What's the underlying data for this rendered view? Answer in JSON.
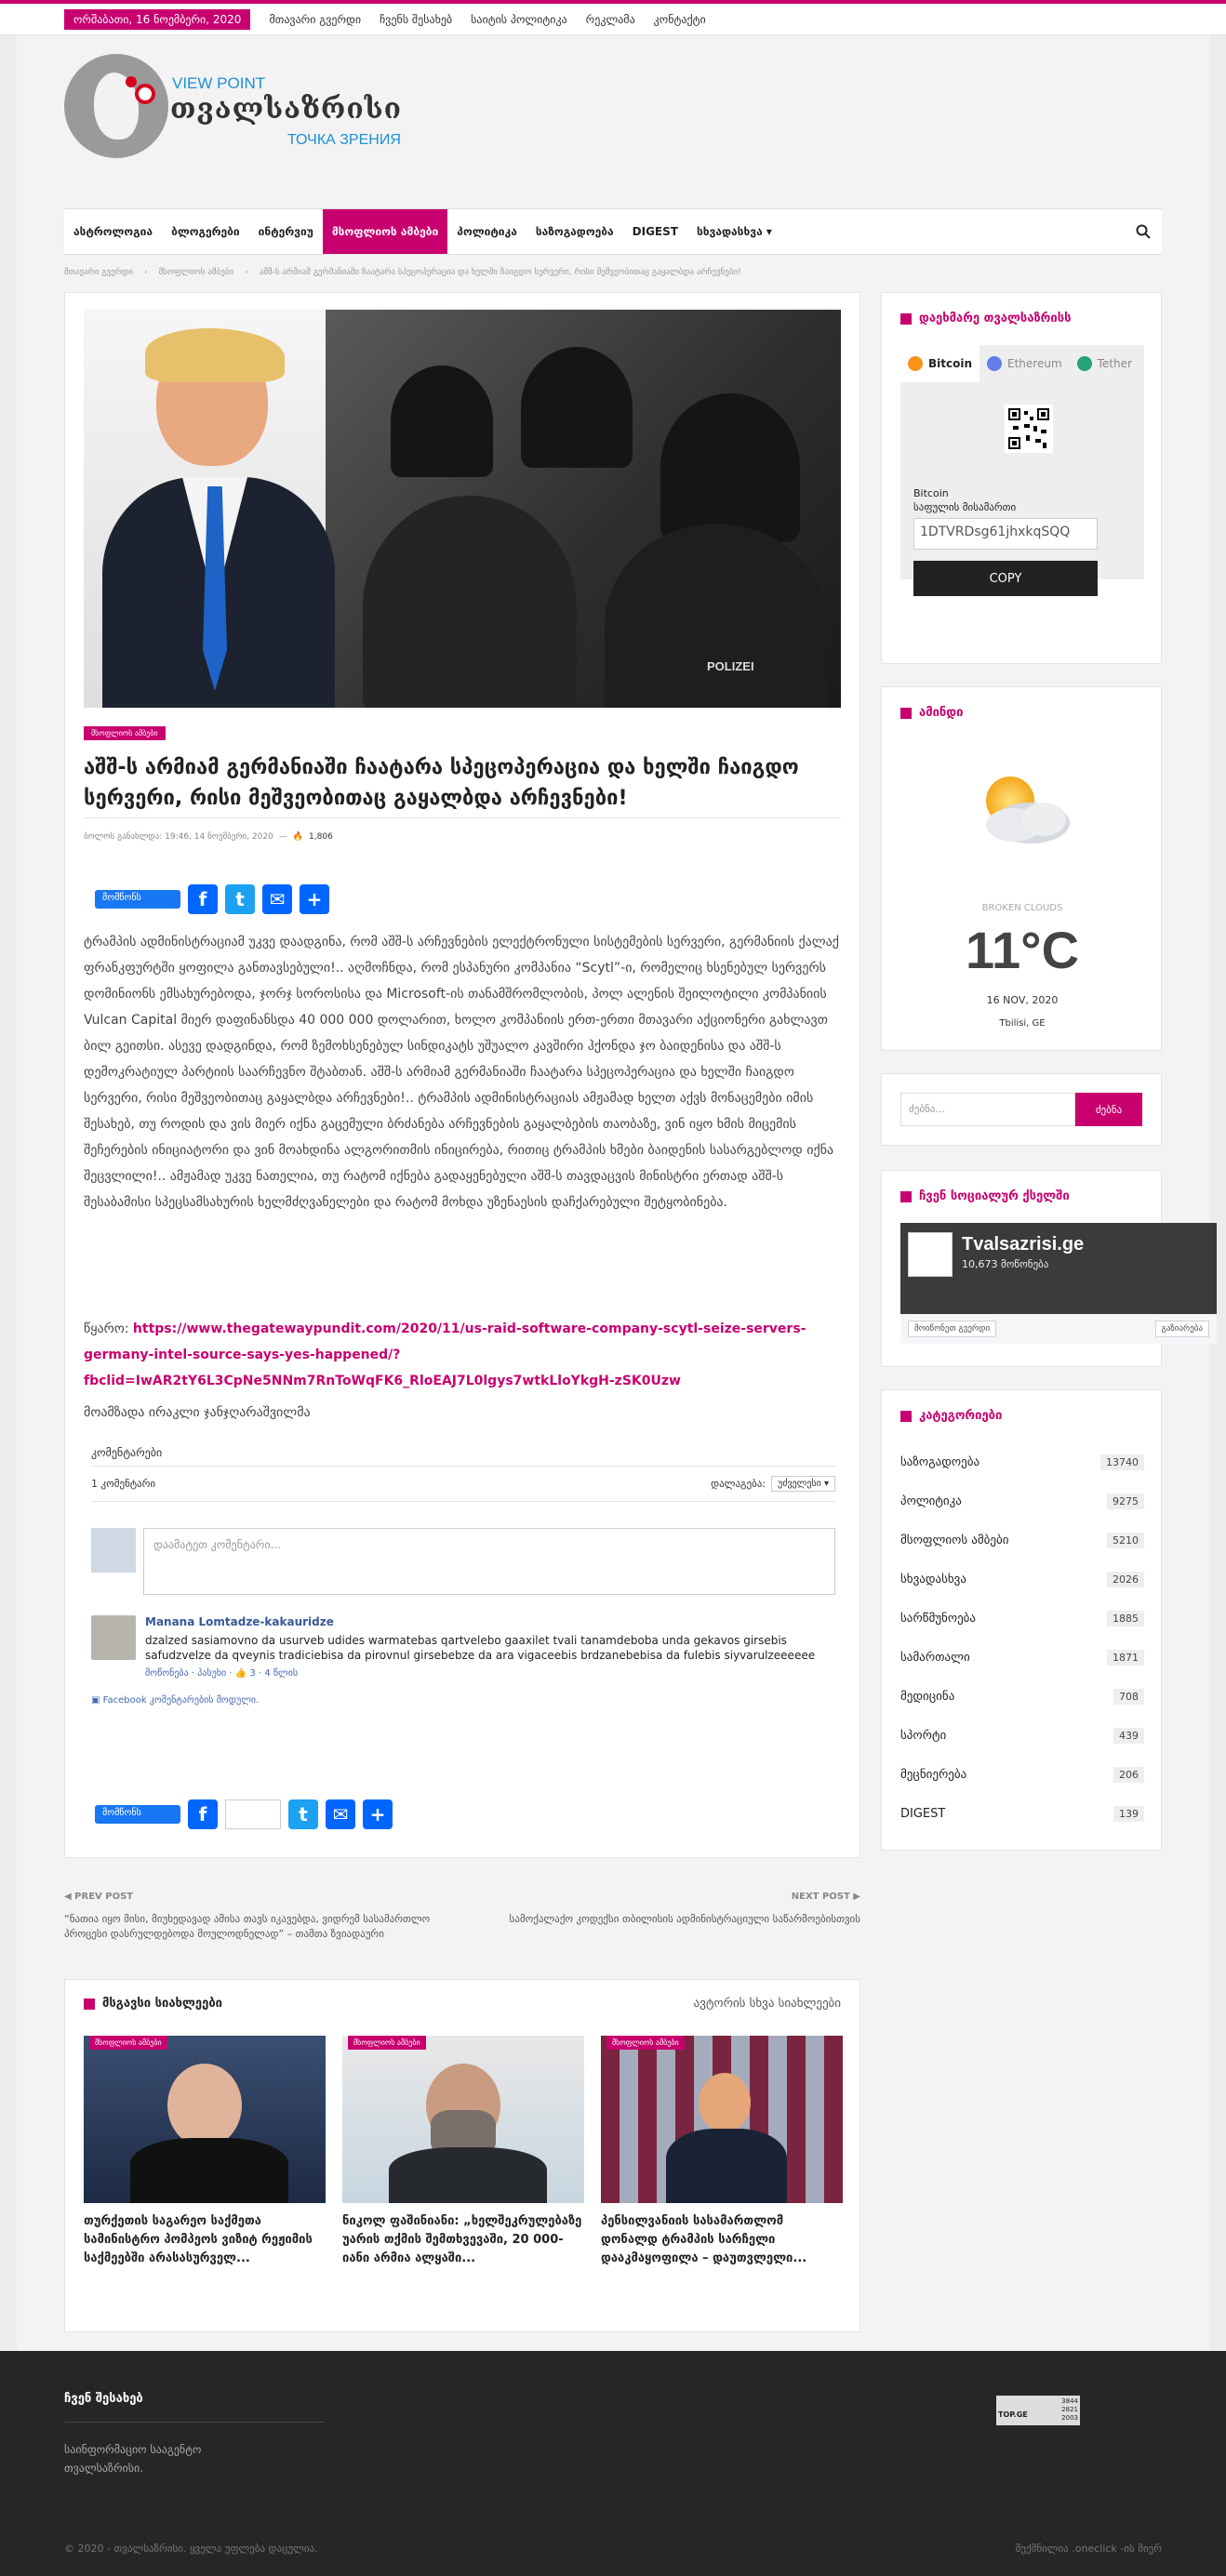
{
  "topbar": {
    "date": "ორშაბათი, 16 ნოემბერი, 2020",
    "links": [
      "მთავარი გვერდი",
      "ჩვენს შესახებ",
      "საიტის პოლიტიკა",
      "რეკლამა",
      "კონტაქტი"
    ]
  },
  "logo": {
    "en": "VIEW POINT",
    "geo": "თვალსაზრისი",
    "ru": "ТОЧКА ЗРЕНИЯ"
  },
  "nav": {
    "items": [
      "ასტროლოგია",
      "ბლოგერები",
      "ინტერვიუ",
      "მსოფლიოს ამბები",
      "პოლიტიკა",
      "საზოგადოება",
      "DIGEST",
      "სხვადასხვა ▾"
    ],
    "active_index": 3
  },
  "breadcrumb": [
    "მთავარი გვერდი",
    "მსოფლიოს ამბები",
    "აშშ-ს არმიამ გერმანიაში ჩაატარა სპეცოპერაცია და ხელში ჩაიგდო სერვერი, რისი მეშვეობითაც გაყალბდა არჩევნები!"
  ],
  "article": {
    "category": "მსოფლიოს ამბები",
    "title": "აშშ-ს არმიამ გერმანიაში ჩაატარა სპეცოპერაცია და ხელში ჩაიგდო სერვერი, რისი მეშვეობითაც გაყალბდა არჩევნები!",
    "meta_date": "ბოლოს განახლდა: 19:46, 14 ნოემბერი, 2020",
    "views": "1,806",
    "hero_caption_text": "POLIZEI",
    "fb_like_label": "მომწონს",
    "body": "ტრამპის ადმინისტრაციამ უკვე დაადგინა, რომ აშშ-ს არჩევნების ელექტრონული სისტემების სერვერი, გერმანიის ქალაქ ფრანკფურტში ყოფილა განთავსებული!.. აღმოჩნდა, რომ ესპანური კომპანია “Scytl”-ი, რომელიც ხსენებულ სერვერს დომინიონს ემსახურებოდა, ჯორჯ სოროსისა და Microsoft-ის თანამშრომლობის, პოლ ალენის შეილოტილი კომპანიის Vulcan Capital მიერ დაფინანსდა 40 000 000 დოლარით, ხოლო კომპანიის ერთ-ერთი მთავარი აქციონერი გახლავთ ბილ გეითსი. ასევე დადგინდა, რომ ზემოხსენებულ სინდიკატს უშუალო კავშირი ჰქონდა ჯო ბაიდენისა და აშშ-ს დემოკრატიულ პარტიის საარჩევნო შტაბთან. აშშ-ს არმიამ გერმანიაში ჩაატარა სპეცოპერაცია და ხელში ჩაიგდო სერვერი, რისი მეშვეობითაც გაყალბდა არჩევნები!.. ტრამპის ადმინისტრაციას ამჟამად ხელთ აქვს მონაცემები იმის შესახებ, თუ როდის და ვის მიერ იქნა გაცემული ბრძანება არჩევნების გაყალბების თაობაზე, ვინ იყო ხმის მიცემის შეჩერების ინიციატორი და ვინ მოახდინა ალგორითმის ინიცირება, რითიც ტრამპის ხმები ბაიდენის სასარგებლოდ იქნა შეცვლილი!.. ამჟამად უკვე ნათელია, თუ რატომ იქნება გადაყენებული აშშ-ს თავდაცვის მინისტრი ერთად აშშ-ს შესაბამისი სპეცსამსახურის ხელმძღვანელები და რატომ მოხდა უზენაესის დაჩქარებული შეტყობინება.",
    "source_label": "წყარო:",
    "source_link": "https://www.thegatewaypundit.com/2020/11/us-raid-software-company-scytl-seize-servers-germany-intel-source-says-yes-happened/?fbclid=IwAR2tY6L3CpNe5NNm7RnToWqFK6_RloEAJ7L0lgys7wtkLloYkgH-zSK0Uzw",
    "author_note": "მოამზადა ირაკლი ჯანჯღარაშვილმა"
  },
  "comments": {
    "header": "კომენტარები",
    "count": "1 კომენტარი",
    "sort_label": "დალაგება:",
    "sort_value": "უძველესი ▾",
    "placeholder": "დაამატეთ კომენტარი...",
    "item": {
      "name": "Manana Lomtadze-kakauridze",
      "text": "dzalzed sasiamovno da usurveb udides warmatebas qartvelebo gaaxilet tvali tanamdeboba unda gekavos girsebis safudzvelze da qveynis tradiciebisa da pirovnul girsebebze da ara vigaceebis brdzanebebisa da fulebis siyvarulzeeeeee",
      "actions": "მოწონება · პასუხი · ",
      "likes": "3",
      "age": "4 წლის"
    },
    "plugin": "Facebook კომენტარების მოდული."
  },
  "postnav": {
    "prev_label": "PREV POST",
    "prev_title": "“ნათია იყო მისი, მიუხედავად ამისა თავს იკავებდა, ვიდრემ სასამართლო პროცესი დასრულდებოდა მოულოდნელად” – თამთა ზვიადაური",
    "next_label": "NEXT POST",
    "next_title": "სამოქალაქო კოდექსი თბილისის ადმინისტრაციული საწარმოებისთვის"
  },
  "related": {
    "title": "მსგავსი სიახლეები",
    "alt": "ავტორის სხვა სიახლეები",
    "cards": [
      {
        "badge": "მსოფლიოს ამბები",
        "title": "თურქეთის საგარეო საქმეთა სამინისტრო პომპეოს ვიზიტ რეჟიმის საქმეებში არასასურველ..."
      },
      {
        "badge": "მსოფლიოს ამბები",
        "title": "ნიკოლ ფაშინიანი: „ხელშეკრულებაზე უარის თქმის შემთხვევაში, 20 000-იანი არმია ალყაში..."
      },
      {
        "badge": "მსოფლიოს ამბები",
        "title": "პენსილვანიის სასამართლომ დონალდ ტრამპის სარჩელი დააკმაყოფილა – დაუთვლელი..."
      }
    ]
  },
  "sidebar": {
    "support_title": "დაეხმარე თვალსაზრისს",
    "crypto_tabs": [
      "Bitcoin",
      "Ethereum",
      "Tether"
    ],
    "crypto_label_1": "Bitcoin",
    "crypto_label_2": "საფულის მისამართი",
    "crypto_address": "1DTVRDsg61jhxkqSQQ",
    "copy": "COPY",
    "weather_title": "ამინდი",
    "weather_desc": "BROKEN CLOUDS",
    "weather_temp": "11°C",
    "weather_date": "16 NOV, 2020",
    "weather_loc": "Tbilisi, GE",
    "search_placeholder": "ძებნა...",
    "search_button": "ძებნა",
    "social_title": "ჩვენ სოციალურ ქსელში",
    "fb_page_name": "Tvalsazrisi.ge",
    "fb_page_likes": "10,673 მოწონება",
    "fb_like_page": "მოიწონეთ გვერდი",
    "fb_share": "გაზიარება",
    "cat_title": "კატეგორიები",
    "categories": [
      {
        "name": "საზოგადოება",
        "count": "13740"
      },
      {
        "name": "პოლიტიკა",
        "count": "9275"
      },
      {
        "name": "მსოფლიოს ამბები",
        "count": "5210"
      },
      {
        "name": "სხვადასხვა",
        "count": "2026"
      },
      {
        "name": "სარწმუნოება",
        "count": "1885"
      },
      {
        "name": "სამართალი",
        "count": "1871"
      },
      {
        "name": "მედიცინა",
        "count": "708"
      },
      {
        "name": "სპორტი",
        "count": "439"
      },
      {
        "name": "მეცნიერება",
        "count": "206"
      },
      {
        "name": "DIGEST",
        "count": "139"
      }
    ]
  },
  "footer": {
    "title": "ჩვენ შესახებ",
    "desc": "საინფორმაციო სააგენტო თვალსაზრისი.",
    "counter_label": "TOP.GE",
    "counter_nums": "3844\n2821\n2003",
    "copyright": "© 2020 - თვალსაზრისი. ყველა უფლება დაცულია.",
    "made": "შექმნილია .oneclick -ის მიერ"
  },
  "colors": {
    "accent": "#c8006f",
    "footer_bg": "#262626",
    "link": "#385898"
  }
}
